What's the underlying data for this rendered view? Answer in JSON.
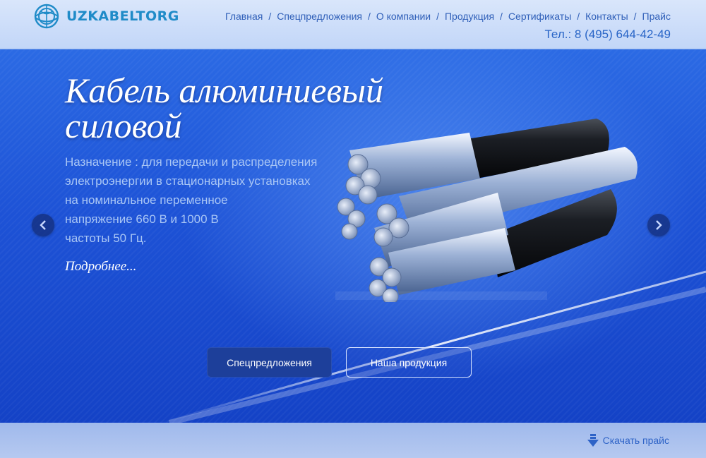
{
  "brand": {
    "logo_text": "UZKABELTORG"
  },
  "nav": {
    "items": [
      "Главная",
      "Спецпредложения",
      "О компании",
      "Продукция",
      "Сертификаты",
      "Контакты",
      "Прайс"
    ],
    "separator": "/"
  },
  "phone": "Тел.: 8 (495) 644-42-49",
  "slide": {
    "title_lines": [
      "Кабель алюминиевый",
      "силовой"
    ],
    "description_lines": [
      "Назначение : для передачи и распределения",
      "электроэнергии в стационарных установках",
      "на номинальное переменное",
      "напряжение 660 В и 1000 В",
      "частоты 50 Гц."
    ],
    "more_link": "Подробнее..."
  },
  "carousel": {
    "prev_icon": "chevron-left-icon",
    "next_icon": "chevron-right-icon"
  },
  "buttons": {
    "special": "Спецпредложения",
    "products": "Наша продукция"
  },
  "footer": {
    "download_label": "Скачать прайс",
    "download_icon": "download-arrow-icon"
  },
  "colors": {
    "header_bg": "#cfdffa",
    "hero_bg": "#1d52d6",
    "link": "#2f5fb8",
    "logo": "#1f8bc8"
  }
}
